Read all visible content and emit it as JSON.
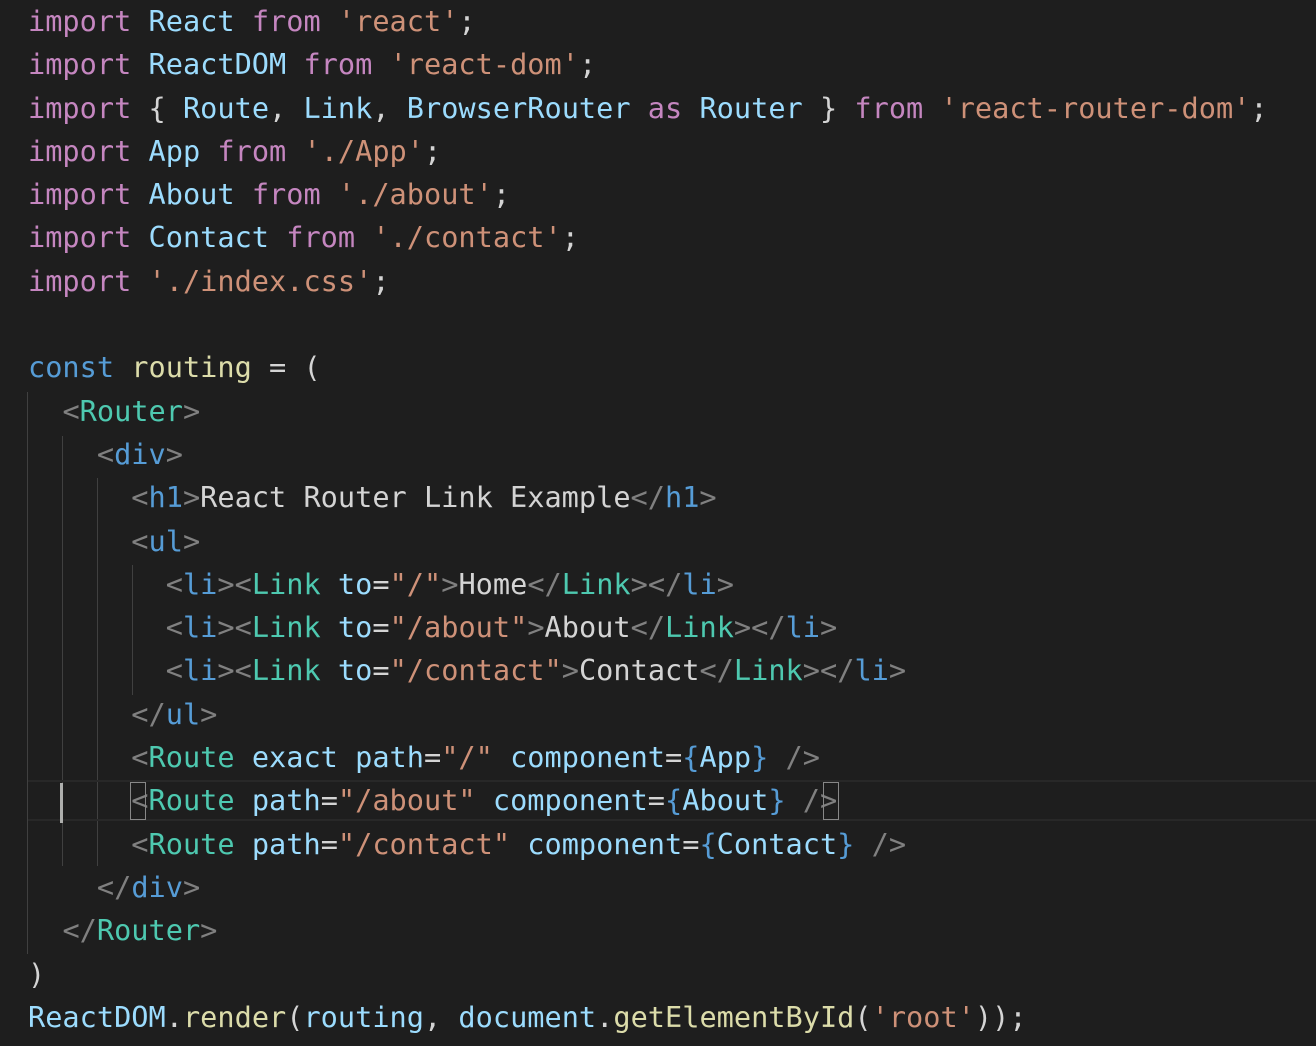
{
  "editor": {
    "lines": [
      [
        {
          "t": "import",
          "c": "kw"
        },
        {
          "t": " ",
          "c": "plain"
        },
        {
          "t": "React",
          "c": "var"
        },
        {
          "t": " ",
          "c": "plain"
        },
        {
          "t": "from",
          "c": "kw"
        },
        {
          "t": " ",
          "c": "plain"
        },
        {
          "t": "'react'",
          "c": "str"
        },
        {
          "t": ";",
          "c": "plain"
        }
      ],
      [
        {
          "t": "import",
          "c": "kw"
        },
        {
          "t": " ",
          "c": "plain"
        },
        {
          "t": "ReactDOM",
          "c": "var"
        },
        {
          "t": " ",
          "c": "plain"
        },
        {
          "t": "from",
          "c": "kw"
        },
        {
          "t": " ",
          "c": "plain"
        },
        {
          "t": "'react-dom'",
          "c": "str"
        },
        {
          "t": ";",
          "c": "plain"
        }
      ],
      [
        {
          "t": "import",
          "c": "kw"
        },
        {
          "t": " { ",
          "c": "plain"
        },
        {
          "t": "Route",
          "c": "var"
        },
        {
          "t": ", ",
          "c": "plain"
        },
        {
          "t": "Link",
          "c": "var"
        },
        {
          "t": ", ",
          "c": "plain"
        },
        {
          "t": "BrowserRouter",
          "c": "var"
        },
        {
          "t": " ",
          "c": "plain"
        },
        {
          "t": "as",
          "c": "kw"
        },
        {
          "t": " ",
          "c": "plain"
        },
        {
          "t": "Router",
          "c": "var"
        },
        {
          "t": " } ",
          "c": "plain"
        },
        {
          "t": "from",
          "c": "kw"
        },
        {
          "t": " ",
          "c": "plain"
        },
        {
          "t": "'react-router-dom'",
          "c": "str"
        },
        {
          "t": ";",
          "c": "plain"
        }
      ],
      [
        {
          "t": "import",
          "c": "kw"
        },
        {
          "t": " ",
          "c": "plain"
        },
        {
          "t": "App",
          "c": "var"
        },
        {
          "t": " ",
          "c": "plain"
        },
        {
          "t": "from",
          "c": "kw"
        },
        {
          "t": " ",
          "c": "plain"
        },
        {
          "t": "'./App'",
          "c": "str"
        },
        {
          "t": ";",
          "c": "plain"
        }
      ],
      [
        {
          "t": "import",
          "c": "kw"
        },
        {
          "t": " ",
          "c": "plain"
        },
        {
          "t": "About",
          "c": "var"
        },
        {
          "t": " ",
          "c": "plain"
        },
        {
          "t": "from",
          "c": "kw"
        },
        {
          "t": " ",
          "c": "plain"
        },
        {
          "t": "'./about'",
          "c": "str"
        },
        {
          "t": ";",
          "c": "plain"
        }
      ],
      [
        {
          "t": "import",
          "c": "kw"
        },
        {
          "t": " ",
          "c": "plain"
        },
        {
          "t": "Contact",
          "c": "var"
        },
        {
          "t": " ",
          "c": "plain"
        },
        {
          "t": "from",
          "c": "kw"
        },
        {
          "t": " ",
          "c": "plain"
        },
        {
          "t": "'./contact'",
          "c": "str"
        },
        {
          "t": ";",
          "c": "plain"
        }
      ],
      [
        {
          "t": "import",
          "c": "kw"
        },
        {
          "t": " ",
          "c": "plain"
        },
        {
          "t": "'./index.css'",
          "c": "str"
        },
        {
          "t": ";",
          "c": "plain"
        }
      ],
      [],
      [
        {
          "t": "const",
          "c": "kw2"
        },
        {
          "t": " ",
          "c": "plain"
        },
        {
          "t": "routing",
          "c": "fn"
        },
        {
          "t": " = (",
          "c": "plain"
        }
      ],
      [
        {
          "t": "  ",
          "c": "plain"
        },
        {
          "t": "<",
          "c": "ang"
        },
        {
          "t": "Router",
          "c": "tag"
        },
        {
          "t": ">",
          "c": "ang"
        }
      ],
      [
        {
          "t": "    ",
          "c": "plain"
        },
        {
          "t": "<",
          "c": "ang"
        },
        {
          "t": "div",
          "c": "htag"
        },
        {
          "t": ">",
          "c": "ang"
        }
      ],
      [
        {
          "t": "      ",
          "c": "plain"
        },
        {
          "t": "<",
          "c": "ang"
        },
        {
          "t": "h1",
          "c": "htag"
        },
        {
          "t": ">",
          "c": "ang"
        },
        {
          "t": "React Router Link Example",
          "c": "txt"
        },
        {
          "t": "</",
          "c": "ang"
        },
        {
          "t": "h1",
          "c": "htag"
        },
        {
          "t": ">",
          "c": "ang"
        }
      ],
      [
        {
          "t": "      ",
          "c": "plain"
        },
        {
          "t": "<",
          "c": "ang"
        },
        {
          "t": "ul",
          "c": "htag"
        },
        {
          "t": ">",
          "c": "ang"
        }
      ],
      [
        {
          "t": "        ",
          "c": "plain"
        },
        {
          "t": "<",
          "c": "ang"
        },
        {
          "t": "li",
          "c": "htag"
        },
        {
          "t": "><",
          "c": "ang"
        },
        {
          "t": "Link",
          "c": "tag"
        },
        {
          "t": " ",
          "c": "plain"
        },
        {
          "t": "to",
          "c": "attr"
        },
        {
          "t": "=",
          "c": "plain"
        },
        {
          "t": "\"/\"",
          "c": "str"
        },
        {
          "t": ">",
          "c": "ang"
        },
        {
          "t": "Home",
          "c": "txt"
        },
        {
          "t": "</",
          "c": "ang"
        },
        {
          "t": "Link",
          "c": "tag"
        },
        {
          "t": "></",
          "c": "ang"
        },
        {
          "t": "li",
          "c": "htag"
        },
        {
          "t": ">",
          "c": "ang"
        }
      ],
      [
        {
          "t": "        ",
          "c": "plain"
        },
        {
          "t": "<",
          "c": "ang"
        },
        {
          "t": "li",
          "c": "htag"
        },
        {
          "t": "><",
          "c": "ang"
        },
        {
          "t": "Link",
          "c": "tag"
        },
        {
          "t": " ",
          "c": "plain"
        },
        {
          "t": "to",
          "c": "attr"
        },
        {
          "t": "=",
          "c": "plain"
        },
        {
          "t": "\"/about\"",
          "c": "str"
        },
        {
          "t": ">",
          "c": "ang"
        },
        {
          "t": "About",
          "c": "txt"
        },
        {
          "t": "</",
          "c": "ang"
        },
        {
          "t": "Link",
          "c": "tag"
        },
        {
          "t": "></",
          "c": "ang"
        },
        {
          "t": "li",
          "c": "htag"
        },
        {
          "t": ">",
          "c": "ang"
        }
      ],
      [
        {
          "t": "        ",
          "c": "plain"
        },
        {
          "t": "<",
          "c": "ang"
        },
        {
          "t": "li",
          "c": "htag"
        },
        {
          "t": "><",
          "c": "ang"
        },
        {
          "t": "Link",
          "c": "tag"
        },
        {
          "t": " ",
          "c": "plain"
        },
        {
          "t": "to",
          "c": "attr"
        },
        {
          "t": "=",
          "c": "plain"
        },
        {
          "t": "\"/contact\"",
          "c": "str"
        },
        {
          "t": ">",
          "c": "ang"
        },
        {
          "t": "Contact",
          "c": "txt"
        },
        {
          "t": "</",
          "c": "ang"
        },
        {
          "t": "Link",
          "c": "tag"
        },
        {
          "t": "></",
          "c": "ang"
        },
        {
          "t": "li",
          "c": "htag"
        },
        {
          "t": ">",
          "c": "ang"
        }
      ],
      [
        {
          "t": "      ",
          "c": "plain"
        },
        {
          "t": "</",
          "c": "ang"
        },
        {
          "t": "ul",
          "c": "htag"
        },
        {
          "t": ">",
          "c": "ang"
        }
      ],
      [
        {
          "t": "      ",
          "c": "plain"
        },
        {
          "t": "<",
          "c": "ang"
        },
        {
          "t": "Route",
          "c": "tag"
        },
        {
          "t": " ",
          "c": "plain"
        },
        {
          "t": "exact",
          "c": "attr"
        },
        {
          "t": " ",
          "c": "plain"
        },
        {
          "t": "path",
          "c": "attr"
        },
        {
          "t": "=",
          "c": "plain"
        },
        {
          "t": "\"/\"",
          "c": "str"
        },
        {
          "t": " ",
          "c": "plain"
        },
        {
          "t": "component",
          "c": "attr"
        },
        {
          "t": "=",
          "c": "plain"
        },
        {
          "t": "{",
          "c": "brace"
        },
        {
          "t": "App",
          "c": "var"
        },
        {
          "t": "}",
          "c": "brace"
        },
        {
          "t": " ",
          "c": "plain"
        },
        {
          "t": "/>",
          "c": "ang"
        }
      ],
      [
        {
          "t": "      ",
          "c": "plain"
        },
        {
          "t": "<",
          "c": "ang"
        },
        {
          "t": "Route",
          "c": "tag"
        },
        {
          "t": " ",
          "c": "plain"
        },
        {
          "t": "path",
          "c": "attr"
        },
        {
          "t": "=",
          "c": "plain"
        },
        {
          "t": "\"/about\"",
          "c": "str"
        },
        {
          "t": " ",
          "c": "plain"
        },
        {
          "t": "component",
          "c": "attr"
        },
        {
          "t": "=",
          "c": "plain"
        },
        {
          "t": "{",
          "c": "brace"
        },
        {
          "t": "About",
          "c": "var"
        },
        {
          "t": "}",
          "c": "brace"
        },
        {
          "t": " ",
          "c": "plain"
        },
        {
          "t": "/>",
          "c": "ang"
        }
      ],
      [
        {
          "t": "      ",
          "c": "plain"
        },
        {
          "t": "<",
          "c": "ang"
        },
        {
          "t": "Route",
          "c": "tag"
        },
        {
          "t": " ",
          "c": "plain"
        },
        {
          "t": "path",
          "c": "attr"
        },
        {
          "t": "=",
          "c": "plain"
        },
        {
          "t": "\"/contact\"",
          "c": "str"
        },
        {
          "t": " ",
          "c": "plain"
        },
        {
          "t": "component",
          "c": "attr"
        },
        {
          "t": "=",
          "c": "plain"
        },
        {
          "t": "{",
          "c": "brace"
        },
        {
          "t": "Contact",
          "c": "var"
        },
        {
          "t": "}",
          "c": "brace"
        },
        {
          "t": " ",
          "c": "plain"
        },
        {
          "t": "/>",
          "c": "ang"
        }
      ],
      [
        {
          "t": "    ",
          "c": "plain"
        },
        {
          "t": "</",
          "c": "ang"
        },
        {
          "t": "div",
          "c": "htag"
        },
        {
          "t": ">",
          "c": "ang"
        }
      ],
      [
        {
          "t": "  ",
          "c": "plain"
        },
        {
          "t": "</",
          "c": "ang"
        },
        {
          "t": "Router",
          "c": "tag"
        },
        {
          "t": ">",
          "c": "ang"
        }
      ],
      [
        {
          "t": ")",
          "c": "plain"
        }
      ],
      [
        {
          "t": "ReactDOM",
          "c": "var"
        },
        {
          "t": ".",
          "c": "plain"
        },
        {
          "t": "render",
          "c": "fn"
        },
        {
          "t": "(",
          "c": "plain"
        },
        {
          "t": "routing",
          "c": "var"
        },
        {
          "t": ", ",
          "c": "plain"
        },
        {
          "t": "document",
          "c": "var"
        },
        {
          "t": ".",
          "c": "plain"
        },
        {
          "t": "getElementById",
          "c": "fn"
        },
        {
          "t": "(",
          "c": "plain"
        },
        {
          "t": "'root'",
          "c": "str"
        },
        {
          "t": "));",
          "c": "plain"
        }
      ]
    ],
    "current_line_index": 18
  },
  "colors": {
    "background": "#1e1e1e",
    "keyword": "#c586c0",
    "storage": "#569cd6",
    "variable": "#9cdcfe",
    "function": "#dcdcaa",
    "string": "#ce9178",
    "component_tag": "#4ec9b0",
    "html_tag": "#569cd6",
    "punctuation": "#808080",
    "text": "#d4d4d4"
  }
}
